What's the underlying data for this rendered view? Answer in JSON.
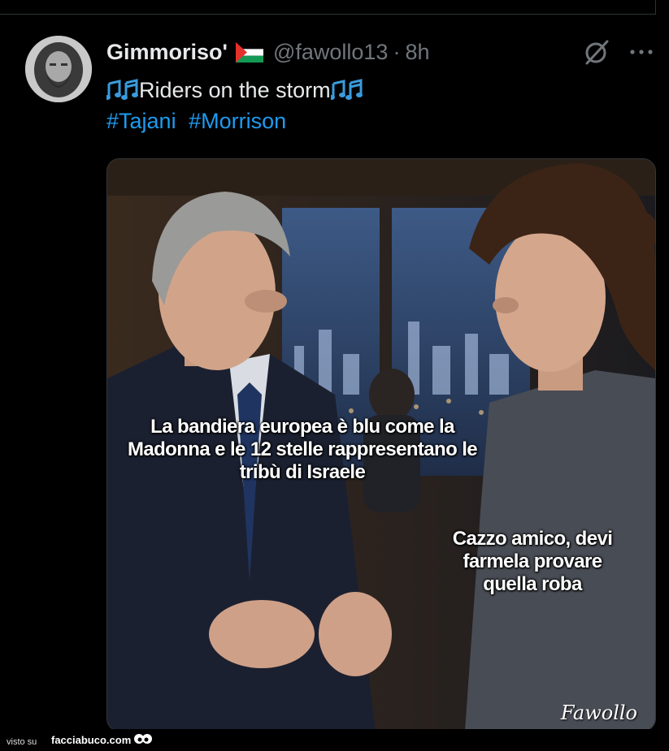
{
  "post": {
    "display_name": "Gimmoriso'",
    "handle": "@fawollo13",
    "separator": "·",
    "time": "8h",
    "text": "Riders on the storm",
    "hashtags": [
      "#Tajani",
      "#Morrison"
    ]
  },
  "media": {
    "caption_left": "La bandiera europea è blu come la Madonna e le 12 stelle rappresentano le tribù di Israele",
    "caption_right": "Cazzo amico, devi farmela provare quella roba",
    "signature": "Fawollo"
  },
  "footer": {
    "visto_su": "visto su",
    "site": "facciabuco.com"
  },
  "icons": {
    "flag": "palestine-flag-icon",
    "notes": "music-notes-icon",
    "grok": "grok-icon",
    "more": "more-icon"
  },
  "colors": {
    "background": "#000000",
    "text": "#e7e9ea",
    "secondary": "#71767b",
    "link": "#1d9bf0"
  }
}
